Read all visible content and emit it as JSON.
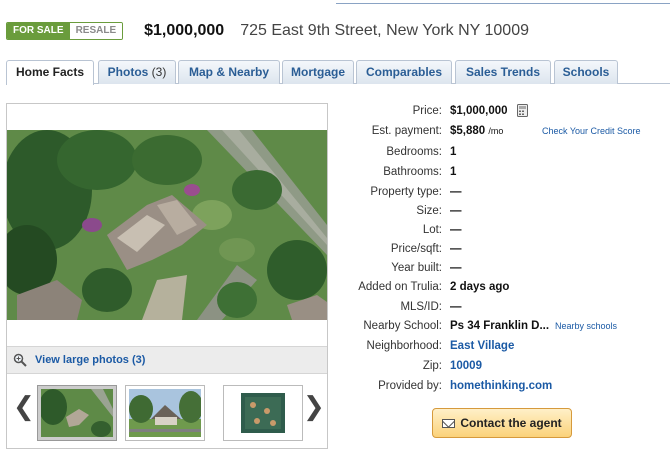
{
  "listing": {
    "badge_sale": "FOR SALE",
    "badge_resale": "RESALE",
    "price": "$1,000,000",
    "address": "725 East 9th Street, New York NY 10009"
  },
  "tabs": [
    {
      "label": "Home Facts",
      "count": ""
    },
    {
      "label": "Photos",
      "count": "(3)"
    },
    {
      "label": "Map & Nearby",
      "count": ""
    },
    {
      "label": "Mortgage",
      "count": ""
    },
    {
      "label": "Comparables",
      "count": ""
    },
    {
      "label": "Sales Trends",
      "count": ""
    },
    {
      "label": "Schools",
      "count": ""
    }
  ],
  "photos": {
    "view_large": "View large photos (3)",
    "prev_arrow": "❮",
    "next_arrow": "❯"
  },
  "facts": {
    "price": {
      "label": "Price:",
      "value": "$1,000,000"
    },
    "payment": {
      "label": "Est. payment:",
      "value": "$5,880",
      "unit": "/mo",
      "link": "Check Your Credit Score"
    },
    "bedrooms": {
      "label": "Bedrooms:",
      "value": "1"
    },
    "bathrooms": {
      "label": "Bathrooms:",
      "value": "1"
    },
    "property_type": {
      "label": "Property type:",
      "value": "—"
    },
    "size": {
      "label": "Size:",
      "value": "—"
    },
    "lot": {
      "label": "Lot:",
      "value": "—"
    },
    "price_sqft": {
      "label": "Price/sqft:",
      "value": "—"
    },
    "year_built": {
      "label": "Year built:",
      "value": "—"
    },
    "added": {
      "label": "Added on Trulia:",
      "value": "2 days ago"
    },
    "mls": {
      "label": "MLS/ID:",
      "value": "—"
    },
    "school": {
      "label": "Nearby School:",
      "value": "Ps 34 Franklin D...",
      "link": "Nearby schools"
    },
    "neighborhood": {
      "label": "Neighborhood:",
      "value": "East Village"
    },
    "zip": {
      "label": "Zip:",
      "value": "10009"
    },
    "provided_by": {
      "label": "Provided by:",
      "value": "homethinking.com"
    }
  },
  "contact_label": "Contact the agent",
  "colors": {
    "badge_green": "#6a9c3c",
    "link_blue": "#1b5aa5",
    "button_orange": "#fbd27a"
  }
}
